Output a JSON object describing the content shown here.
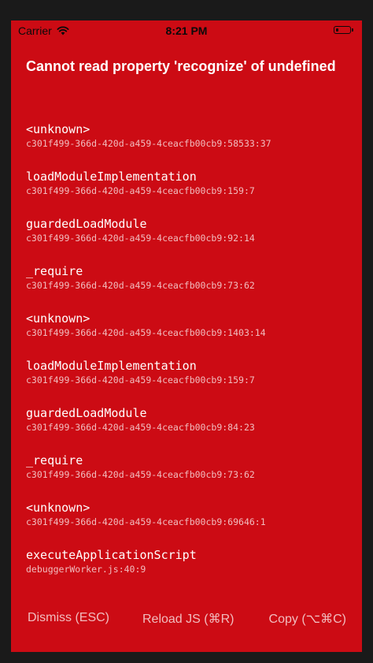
{
  "status_bar": {
    "carrier": "Carrier",
    "time": "8:21 PM",
    "battery_level": 0.2
  },
  "error": {
    "title": "Cannot read property 'recognize' of undefined"
  },
  "stack": [
    {
      "method": "<unknown>",
      "location": "c301f499-366d-420d-a459-4ceacfb00cb9:58533:37"
    },
    {
      "method": "loadModuleImplementation",
      "location": "c301f499-366d-420d-a459-4ceacfb00cb9:159:7"
    },
    {
      "method": "guardedLoadModule",
      "location": "c301f499-366d-420d-a459-4ceacfb00cb9:92:14"
    },
    {
      "method": "_require",
      "location": "c301f499-366d-420d-a459-4ceacfb00cb9:73:62"
    },
    {
      "method": "<unknown>",
      "location": "c301f499-366d-420d-a459-4ceacfb00cb9:1403:14"
    },
    {
      "method": "loadModuleImplementation",
      "location": "c301f499-366d-420d-a459-4ceacfb00cb9:159:7"
    },
    {
      "method": "guardedLoadModule",
      "location": "c301f499-366d-420d-a459-4ceacfb00cb9:84:23"
    },
    {
      "method": "_require",
      "location": "c301f499-366d-420d-a459-4ceacfb00cb9:73:62"
    },
    {
      "method": "<unknown>",
      "location": "c301f499-366d-420d-a459-4ceacfb00cb9:69646:1"
    },
    {
      "method": "executeApplicationScript",
      "location": "debuggerWorker.js:40:9"
    }
  ],
  "footer": {
    "dismiss_label": "Dismiss (ESC)",
    "reload_label": "Reload JS (⌘R)",
    "copy_label": "Copy (⌥⌘C)"
  },
  "colors": {
    "background": "#cc0b14",
    "text": "#ffffff"
  }
}
